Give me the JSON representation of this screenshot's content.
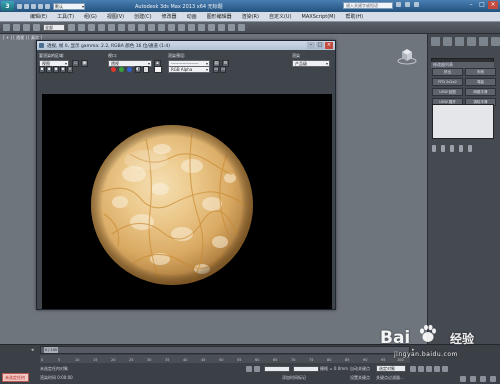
{
  "app": {
    "logo": "3",
    "workspace": "默认",
    "title": "Autodesk 3ds Max  2013 x64   无标题",
    "search_placeholder": "键入关键字或短语"
  },
  "menubar": [
    "编辑(E)",
    "工具(T)",
    "组(G)",
    "视图(V)",
    "创建(C)",
    "修改器",
    "动画",
    "图形编辑器",
    "渲染(R)",
    "自定义(U)",
    "MAXScript(M)",
    "帮助(H)"
  ],
  "toolbar": {
    "selection_filter": "全部"
  },
  "viewport": {
    "label": "[ + ] [ 透视 ] [ 真实 ]"
  },
  "frame_window": {
    "title": "透视, 帧 0, 显示 gamma: 2.2, RGBA 颜色 16 位/通道 (1:4)",
    "area_label": "要渲染的区域:",
    "area_value": "视图",
    "viewport_label": "视口:",
    "viewport_value": "透视",
    "preset_label": "渲染预设:",
    "preset_value": "-------------------",
    "render_label": "渲染",
    "render_value": "产品级",
    "channel_value": "RGB Alpha",
    "color_red": "#e0352b",
    "color_green": "#37a13c",
    "color_blue": "#2f5fd0"
  },
  "command_panel": {
    "object_name": "",
    "rollout_label": "修改器列表",
    "buttons": [
      "挤出",
      "车削",
      "FFD 2x2x2",
      "弯曲",
      "UVW 贴图",
      "网格平滑",
      "UVW 展开",
      "涡轮平滑"
    ]
  },
  "timeline": {
    "frame_counter": "0 / 100",
    "ruler": [
      "0",
      "5",
      "10",
      "15",
      "20",
      "25",
      "30",
      "35",
      "40",
      "45",
      "50",
      "55",
      "60",
      "65",
      "70",
      "75",
      "80",
      "85",
      "90",
      "95",
      "100"
    ]
  },
  "statusbar": {
    "selected": "未选定任何",
    "line1": "未选定任何对象",
    "line2": "渲染时间 0:00:00",
    "grid": "栅格 = 0.0mm",
    "autokey": "自动关键点",
    "set_key": "设置关键点",
    "key_filters": "关键点过滤器...",
    "add_time_tag": "添加时间标记",
    "selected_obj": "选定对象"
  },
  "watermark": {
    "brand": "Bai",
    "cn": "经验",
    "url": "jingyan.baidu.com"
  }
}
